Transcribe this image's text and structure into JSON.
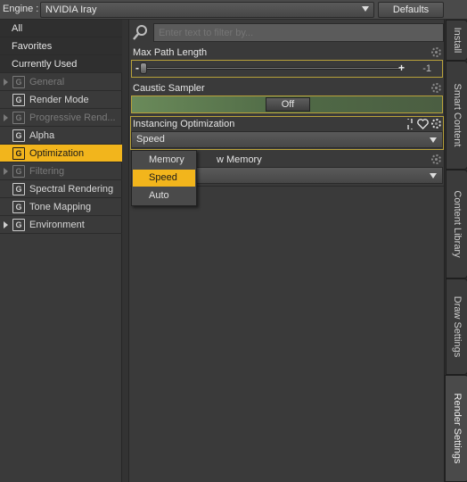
{
  "topbar": {
    "engine_label": "Engine :",
    "engine_value": "NVIDIA Iray",
    "defaults_label": "Defaults"
  },
  "categories": [
    {
      "label": "All"
    },
    {
      "label": "Favorites"
    },
    {
      "label": "Currently Used"
    },
    {
      "label": "General",
      "icon": "G"
    },
    {
      "label": "Render Mode",
      "icon": "G"
    },
    {
      "label": "Progressive Rend...",
      "icon": "G"
    },
    {
      "label": "Alpha",
      "icon": "G"
    },
    {
      "label": "Optimization",
      "icon": "G"
    },
    {
      "label": "Filtering",
      "icon": "G"
    },
    {
      "label": "Spectral Rendering",
      "icon": "G"
    },
    {
      "label": "Tone Mapping",
      "icon": "G"
    },
    {
      "label": "Environment",
      "icon": "G"
    }
  ],
  "filter": {
    "placeholder": "Enter text to filter by..."
  },
  "properties": {
    "max_path_length": {
      "title": "Max Path Length",
      "value": "-1",
      "minus": "-",
      "plus": "+"
    },
    "caustic_sampler": {
      "title": "Caustic Sampler",
      "value": "Off"
    },
    "instancing": {
      "title": "Instancing Optimization",
      "value": "Speed"
    },
    "low_memory": {
      "title_visible": "w Memory"
    }
  },
  "dropdown": {
    "options": [
      "Memory",
      "Speed",
      "Auto"
    ],
    "selected": "Speed"
  },
  "right_tabs": [
    "Install",
    "Smart Content",
    "Content Library",
    "Draw Settings",
    "Render Settings"
  ],
  "colors": {
    "accent": "#f2b51c",
    "highlight_border": "#b9a23a"
  }
}
